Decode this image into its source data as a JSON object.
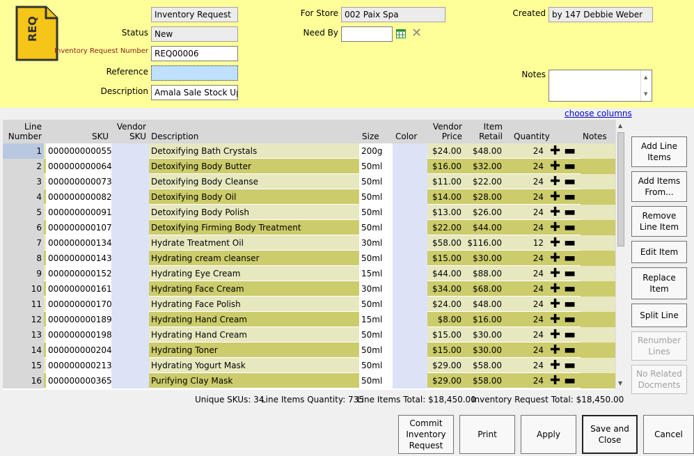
{
  "header": {
    "icon_text": "REQ",
    "title_value": "Inventory Request",
    "status_label": "Status",
    "status_value": "New",
    "number_label": "Inventory Request Number",
    "number_value": "REQ00006",
    "reference_label": "Reference",
    "reference_value": "",
    "description_label": "Description",
    "description_value": "Amala Sale Stock Up",
    "for_store_label": "For Store",
    "for_store_value": "002 Paix Spa",
    "need_by_label": "Need By",
    "need_by_value": "",
    "created_label": "Created",
    "created_value": "by 147 Debbie Weber",
    "notes_label": "Notes",
    "notes_value": "",
    "choose_columns": "choose columns"
  },
  "grid": {
    "columns": {
      "line_number": [
        "Line",
        "Number"
      ],
      "sku": "SKU",
      "vendor_sku": [
        "Vendor",
        "SKU"
      ],
      "description": "Description",
      "size": "Size",
      "color": "Color",
      "vendor_price": [
        "Vendor",
        "Price"
      ],
      "item_retail": [
        "Item",
        "Retail"
      ],
      "quantity": "Quantity",
      "notes": "Notes"
    },
    "rows": [
      {
        "num": "1",
        "sku": "000000000055",
        "vsku": "",
        "desc": "Detoxifying Bath Crystals",
        "size": "200g",
        "color": "",
        "vprice": "$24.00",
        "retail": "$48.00",
        "qty": "24"
      },
      {
        "num": "2",
        "sku": "000000000064",
        "vsku": "",
        "desc": "Detoxifying Body Butter",
        "size": "50ml",
        "color": "",
        "vprice": "$16.00",
        "retail": "$32.00",
        "qty": "24"
      },
      {
        "num": "3",
        "sku": "000000000073",
        "vsku": "",
        "desc": "Detoxifying Body Cleanse",
        "size": "50ml",
        "color": "",
        "vprice": "$11.00",
        "retail": "$22.00",
        "qty": "24"
      },
      {
        "num": "4",
        "sku": "000000000082",
        "vsku": "",
        "desc": "Detoxifying Body Oil",
        "size": "50ml",
        "color": "",
        "vprice": "$14.00",
        "retail": "$28.00",
        "qty": "24"
      },
      {
        "num": "5",
        "sku": "000000000091",
        "vsku": "",
        "desc": "Detoxifying Body Polish",
        "size": "50ml",
        "color": "",
        "vprice": "$13.00",
        "retail": "$26.00",
        "qty": "24"
      },
      {
        "num": "6",
        "sku": "000000000107",
        "vsku": "",
        "desc": "Detoxifying Firming Body Treatment",
        "size": "50ml",
        "color": "",
        "vprice": "$22.00",
        "retail": "$44.00",
        "qty": "24"
      },
      {
        "num": "7",
        "sku": "000000000134",
        "vsku": "",
        "desc": "Hydrate Treatment Oil",
        "size": "30ml",
        "color": "",
        "vprice": "$58.00",
        "retail": "$116.00",
        "qty": "12"
      },
      {
        "num": "8",
        "sku": "000000000143",
        "vsku": "",
        "desc": "Hydrating cream cleanser",
        "size": "50ml",
        "color": "",
        "vprice": "$15.00",
        "retail": "$30.00",
        "qty": "24"
      },
      {
        "num": "9",
        "sku": "000000000152",
        "vsku": "",
        "desc": "Hydrating Eye Cream",
        "size": "15ml",
        "color": "",
        "vprice": "$44.00",
        "retail": "$88.00",
        "qty": "24"
      },
      {
        "num": "10",
        "sku": "000000000161",
        "vsku": "",
        "desc": "Hydrating Face Cream",
        "size": "30ml",
        "color": "",
        "vprice": "$34.00",
        "retail": "$68.00",
        "qty": "24"
      },
      {
        "num": "11",
        "sku": "000000000170",
        "vsku": "",
        "desc": "Hydrating Face Polish",
        "size": "50ml",
        "color": "",
        "vprice": "$24.00",
        "retail": "$48.00",
        "qty": "24"
      },
      {
        "num": "12",
        "sku": "000000000189",
        "vsku": "",
        "desc": "Hydrating Hand Cream",
        "size": "15ml",
        "color": "",
        "vprice": "$8.00",
        "retail": "$16.00",
        "qty": "24"
      },
      {
        "num": "13",
        "sku": "000000000198",
        "vsku": "",
        "desc": "Hydrating Hand Cream",
        "size": "50ml",
        "color": "",
        "vprice": "$15.00",
        "retail": "$30.00",
        "qty": "24"
      },
      {
        "num": "14",
        "sku": "000000000204",
        "vsku": "",
        "desc": "Hydrating Toner",
        "size": "50ml",
        "color": "",
        "vprice": "$15.00",
        "retail": "$30.00",
        "qty": "24"
      },
      {
        "num": "15",
        "sku": "000000000213",
        "vsku": "",
        "desc": "Hydrating Yogurt Mask",
        "size": "50ml",
        "color": "",
        "vprice": "$29.00",
        "retail": "$58.00",
        "qty": "24"
      },
      {
        "num": "16",
        "sku": "000000000365",
        "vsku": "",
        "desc": "Purifying Clay Mask",
        "size": "50ml",
        "color": "",
        "vprice": "$29.00",
        "retail": "$58.00",
        "qty": "24"
      }
    ]
  },
  "side_buttons": {
    "add_line": "Add Line Items",
    "add_items_from": "Add Items From...",
    "remove_line": "Remove Line Item",
    "edit_item": "Edit Item",
    "replace_item": "Replace Item",
    "split_line": "Split Line",
    "renumber_lines": "Renumber Lines",
    "no_related_docs": "No Related Docments"
  },
  "summary": {
    "unique_skus": "Unique SKUs: 34",
    "line_items_qty": "Line Items Quantity: 735",
    "line_items_total": "Line Items Total: $18,450.00",
    "request_total": "Inventory Request Total: $18,450.00"
  },
  "bottom_buttons": {
    "commit": "Commit Inventory Request",
    "print": "Print",
    "apply": "Apply",
    "save_close": "Save and Close",
    "cancel": "Cancel"
  },
  "colors": {
    "header_bg": "#ffff99",
    "row_light": "#e8e8c0",
    "row_dark": "#cccc6c",
    "icon_yellow": "#f5c518"
  }
}
